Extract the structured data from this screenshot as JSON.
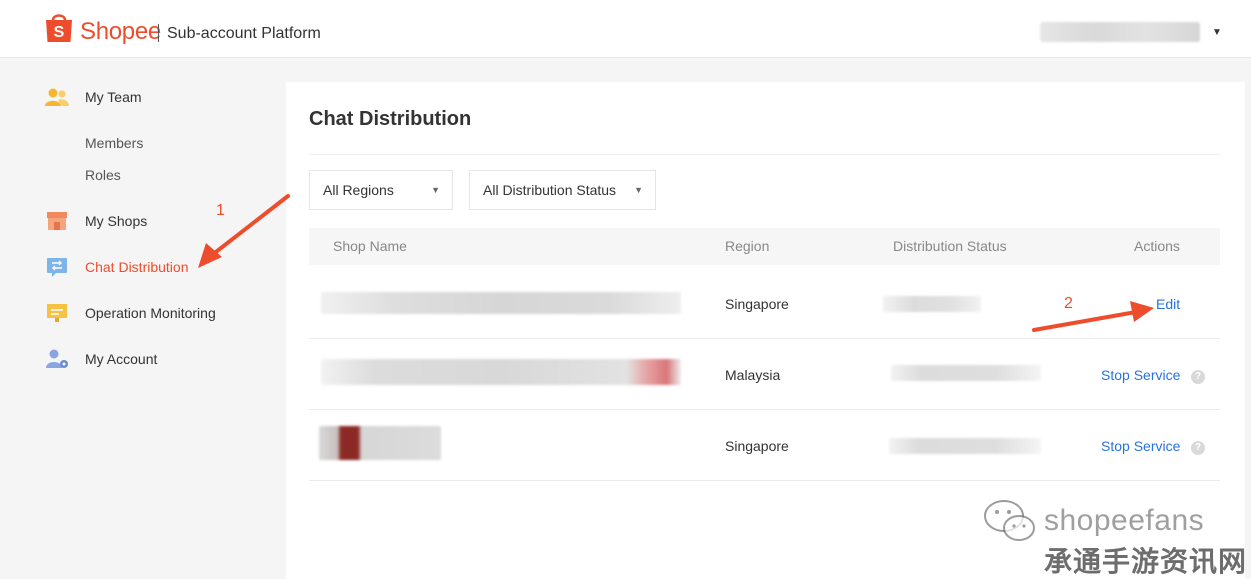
{
  "header": {
    "brand": "Shopee",
    "platform_title": "Sub-account Platform",
    "brand_color": "#ee4d2d"
  },
  "sidebar": {
    "items": [
      {
        "label": "My Team",
        "icon": "team-icon"
      },
      {
        "label": "Members"
      },
      {
        "label": "Roles"
      },
      {
        "label": "My Shops",
        "icon": "shop-icon"
      },
      {
        "label": "Chat Distribution",
        "icon": "chat-distribution-icon",
        "active": true
      },
      {
        "label": "Operation Monitoring",
        "icon": "monitor-icon"
      },
      {
        "label": "My Account",
        "icon": "account-icon"
      }
    ]
  },
  "main": {
    "title": "Chat Distribution",
    "filters": {
      "region": "All Regions",
      "status": "All Distribution Status"
    },
    "table": {
      "columns": [
        "Shop Name",
        "Region",
        "Distribution Status",
        "Actions"
      ],
      "rows": [
        {
          "region": "Singapore",
          "action": "Edit"
        },
        {
          "region": "Malaysia",
          "action": "Stop Service"
        },
        {
          "region": "Singapore",
          "action": "Stop Service"
        }
      ]
    }
  },
  "annotations": {
    "step1": "1",
    "step2": "2",
    "arrow_color": "#ee4d2d"
  },
  "watermark": {
    "text": "shopeefans",
    "cn": "承通手游资讯网"
  },
  "colors": {
    "link": "#2673dd",
    "active": "#ee4d2d"
  }
}
